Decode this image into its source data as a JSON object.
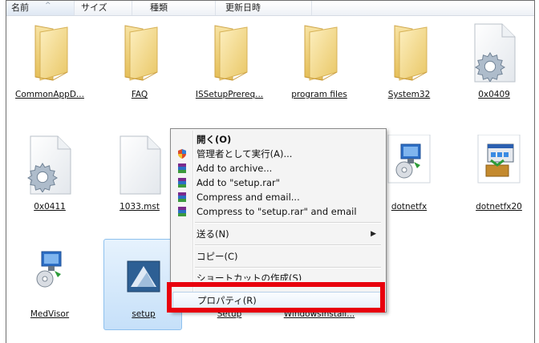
{
  "columns": {
    "name": "名前",
    "size": "サイズ",
    "type": "種類",
    "date": "更新日時"
  },
  "items": [
    {
      "label": "CommonAppD...",
      "icon": "folder-icon"
    },
    {
      "label": "FAQ",
      "icon": "folder-icon"
    },
    {
      "label": "ISSetupPrereq...",
      "icon": "folder-icon"
    },
    {
      "label": "program files",
      "icon": "folder-icon"
    },
    {
      "label": "System32",
      "icon": "folder-icon"
    },
    {
      "label": "0x0409",
      "icon": "settings-file-icon"
    },
    {
      "label": "0x0411",
      "icon": "settings-file-icon"
    },
    {
      "label": "1033.mst",
      "icon": "blank-file-icon"
    },
    {
      "label": "dotnetfx",
      "icon": "installer-icon"
    },
    {
      "label": "dotnetfx20",
      "icon": "installer-window-icon"
    },
    {
      "label": "MedVisor",
      "icon": "installer-icon"
    },
    {
      "label": "setup",
      "icon": "setup-app-icon"
    },
    {
      "label": "Setup",
      "icon": "file-icon"
    },
    {
      "label": "WindowsInstall...",
      "icon": "file-icon"
    }
  ],
  "context_menu": {
    "open": "開く(O)",
    "run_as_admin": "管理者として実行(A)...",
    "add_archive": "Add to archive...",
    "add_setup_rar": "Add to \"setup.rar\"",
    "compress_email": "Compress and email...",
    "compress_setup_email": "Compress to \"setup.rar\" and email",
    "send_to": "送る(N)",
    "copy": "コピー(C)",
    "create_shortcut": "ショートカットの作成(S)",
    "properties": "プロパティ(R)"
  },
  "colors": {
    "highlight": "#e8000d",
    "selection": "#c6e0f9",
    "folder": "#f3d47a"
  }
}
